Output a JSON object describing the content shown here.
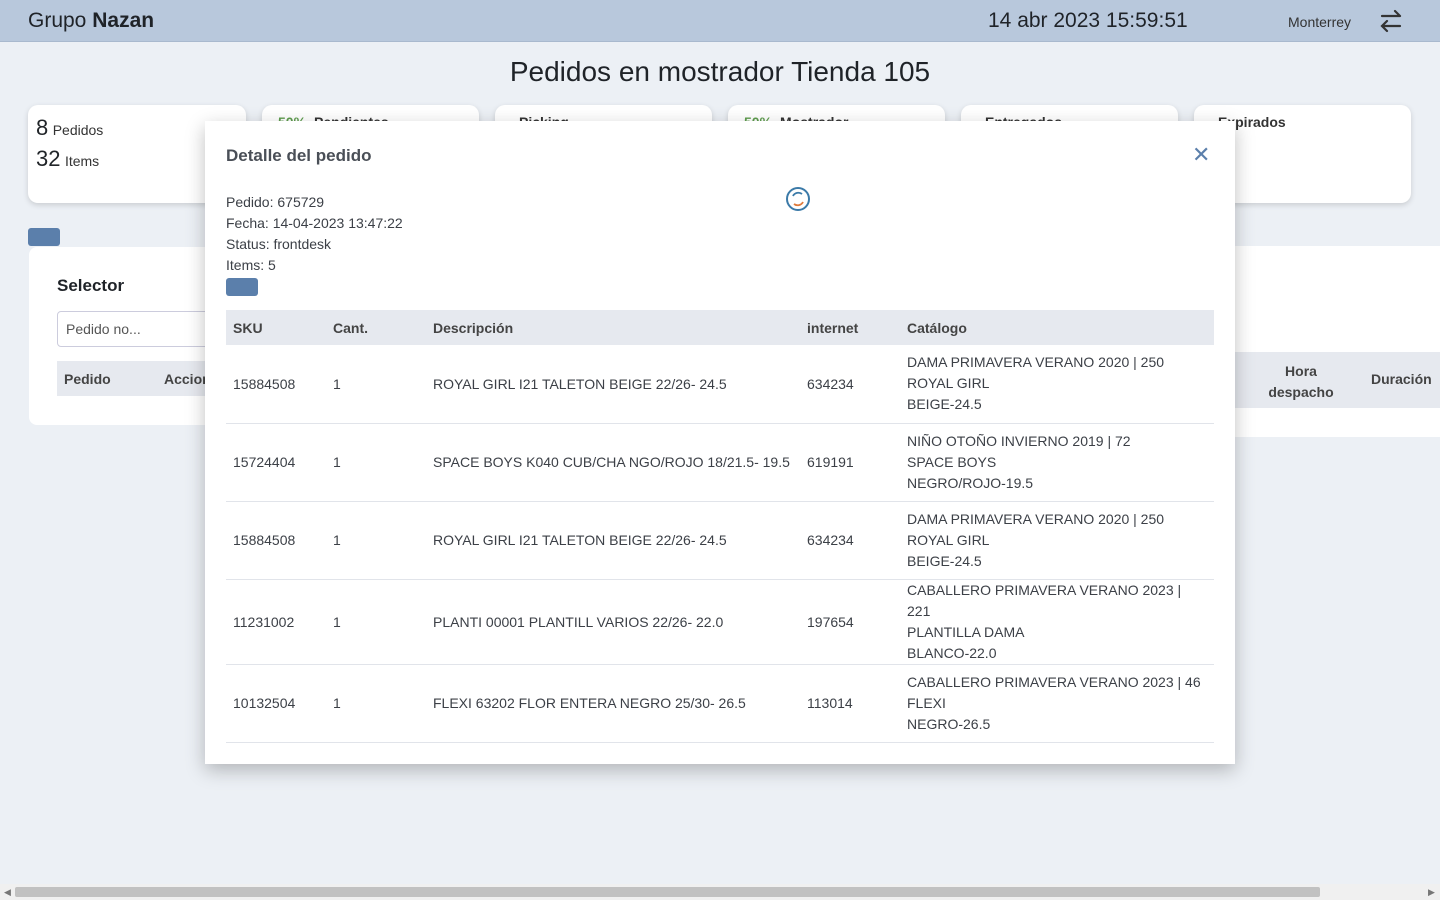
{
  "header": {
    "brand_prefix": "Grupo",
    "brand_bold": "Nazan",
    "datetime": "14 abr 2023 15:59:51",
    "city": "Monterrey",
    "swap_icon": "swap-arrows-icon"
  },
  "page": {
    "title": "Pedidos en mostrador Tienda 105"
  },
  "stats": {
    "pedidos_count": "8",
    "pedidos_label": "Pedidos",
    "items_count": "32",
    "items_label": "Items",
    "cards": [
      {
        "pct": "50%",
        "label": "Pendientes"
      },
      {
        "pct": "",
        "label": "Picking"
      },
      {
        "pct": "50%",
        "label": "Mostrador"
      },
      {
        "pct": "",
        "label": "Entregados"
      },
      {
        "pct": "",
        "label": "Expirados"
      }
    ]
  },
  "selector": {
    "title": "Selector",
    "search_placeholder": "Pedido no...",
    "col_pedido": "Pedido",
    "col_acciones": "Acciones",
    "col_hora": "Hora despacho",
    "col_duracion": "Duración"
  },
  "modal": {
    "title": "Detalle del pedido",
    "close_icon": "close-icon",
    "pedido": "Pedido: 675729",
    "fecha": "Fecha: 14-04-2023 13:47:22",
    "status": "Status: frontdesk",
    "items": "Items: 5",
    "columns": [
      "SKU",
      "Cant.",
      "Descripción",
      "internet",
      "Catálogo"
    ],
    "rows": [
      {
        "sku": "15884508",
        "cant": "1",
        "desc": "ROYAL GIRL I21 TALETON BEIGE 22/26- 24.5",
        "internet": "634234",
        "cat1": "DAMA PRIMAVERA VERANO 2020 | 250",
        "cat2": "ROYAL GIRL",
        "cat3": "BEIGE-24.5"
      },
      {
        "sku": "15724404",
        "cant": "1",
        "desc": "SPACE BOYS K040 CUB/CHA NGO/ROJO 18/21.5- 19.5",
        "internet": "619191",
        "cat1": "NIÑO OTOÑO INVIERNO 2019 | 72",
        "cat2": "SPACE BOYS",
        "cat3": "NEGRO/ROJO-19.5"
      },
      {
        "sku": "15884508",
        "cant": "1",
        "desc": "ROYAL GIRL I21 TALETON BEIGE 22/26- 24.5",
        "internet": "634234",
        "cat1": "DAMA PRIMAVERA VERANO 2020 | 250",
        "cat2": "ROYAL GIRL",
        "cat3": "BEIGE-24.5"
      },
      {
        "sku": "11231002",
        "cant": "1",
        "desc": "PLANTI 00001 PLANTILL VARIOS 22/26- 22.0",
        "internet": "197654",
        "cat1": "CABALLERO PRIMAVERA VERANO 2023 | 221",
        "cat2": "PLANTILLA DAMA",
        "cat3": "BLANCO-22.0"
      },
      {
        "sku": "10132504",
        "cant": "1",
        "desc": "FLEXI 63202 FLOR ENTERA NEGRO 25/30- 26.5",
        "internet": "113014",
        "cat1": "CABALLERO PRIMAVERA VERANO 2023 | 46",
        "cat2": "FLEXI",
        "cat3": "NEGRO-26.5"
      }
    ]
  },
  "colors": {
    "accent": "#5b7fab",
    "header_bg": "#b8c8dc",
    "page_bg": "#ecf0f5"
  }
}
